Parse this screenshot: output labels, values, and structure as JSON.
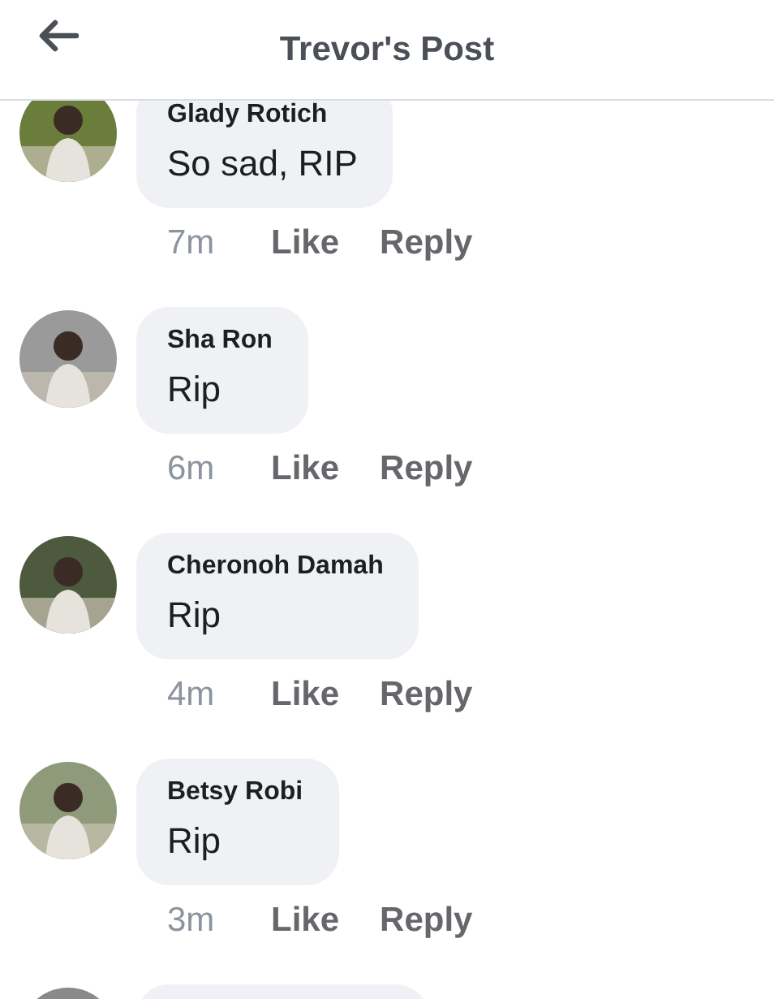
{
  "header": {
    "title": "Trevor's Post"
  },
  "comments": [
    {
      "author": "Glady Rotich",
      "text": "So sad, RIP",
      "time": "7m",
      "like": "Like",
      "reply": "Reply"
    },
    {
      "author": "Sha Ron",
      "text": "Rip",
      "time": "6m",
      "like": "Like",
      "reply": "Reply"
    },
    {
      "author": "Cheronoh Damah",
      "text": "Rip",
      "time": "4m",
      "like": "Like",
      "reply": "Reply"
    },
    {
      "author": "Betsy Robi",
      "text": "Rip",
      "time": "3m",
      "like": "Like",
      "reply": "Reply"
    },
    {
      "cut_off": true
    }
  ]
}
